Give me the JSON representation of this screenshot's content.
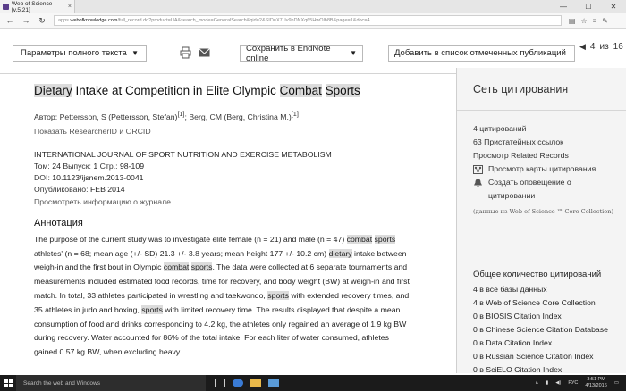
{
  "browser": {
    "tab_title": "Web of Science [v.5.21]",
    "url_prefix": "apps.",
    "url_domain": "webofknowledge.com",
    "url_rest": "/full_record.do?product=UA&search_mode=GeneralSearch&qid=2&SID=X7Uv9hDNXq65HwOlh8B&page=1&doc=4"
  },
  "toolbar": {
    "fulltext_label": "Параметры полного текста",
    "endnote_label": "Сохранить в EndNote online",
    "marked_label": "Добавить в список отмеченных публикаций",
    "page_current": "4",
    "page_of": "из",
    "page_total": "16"
  },
  "record": {
    "title_parts": [
      "Dietary",
      " Intake at Competition in Elite Olympic ",
      "Combat",
      " ",
      "Sports"
    ],
    "author_label": "Автор:",
    "author1": "Pettersson, S",
    "author1_full": "(Pettersson, Stefan)",
    "author1_ref": "[1]",
    "author_sep": "; ",
    "author2": "Berg, CM",
    "author2_full": "(Berg, Christina M.)",
    "author2_ref": "[1]",
    "orcid_link": "Показать ResearcherID и ORCID",
    "journal": "INTERNATIONAL JOURNAL OF SPORT NUTRITION AND EXERCISE METABOLISM",
    "volume_label": "Том:",
    "volume": "24",
    "issue_label": "Выпуск:",
    "issue": "1",
    "pages_label": "Стр.:",
    "pages": "98-109",
    "doi_label": "DOI:",
    "doi": "10.1123/ijsnem.2013-0041",
    "published_label": "Опубликовано:",
    "published": "FEB 2014",
    "journal_info_link": "Просмотреть информацию о журнале",
    "abstract_heading": "Аннотация",
    "abstract_parts": [
      {
        "t": "The purpose of the current study was to investigate elite female (n = 21) and male (n = 47) ",
        "h": false
      },
      {
        "t": "combat",
        "h": true
      },
      {
        "t": " ",
        "h": false
      },
      {
        "t": "sports",
        "h": true
      },
      {
        "t": " athletes' (n = 68; mean age (+/- SD) 21.3 +/- 3.8 years; mean height 177 +/- 10.2 cm) ",
        "h": false
      },
      {
        "t": "dietary",
        "h": true
      },
      {
        "t": " intake between weigh-in and the first bout in Olympic ",
        "h": false
      },
      {
        "t": "combat",
        "h": true
      },
      {
        "t": " ",
        "h": false
      },
      {
        "t": "sports",
        "h": true
      },
      {
        "t": ". The data were collected at 6 separate tournaments and measurements included estimated food records, time for recovery, and body weight (BW) at weigh-in and first match. In total, 33 athletes participated in wrestling and taekwondo, ",
        "h": false
      },
      {
        "t": "sports",
        "h": true
      },
      {
        "t": " with extended recovery times, and 35 athletes in judo and boxing, ",
        "h": false
      },
      {
        "t": "sports",
        "h": true
      },
      {
        "t": " with limited recovery time. The results displayed that despite a mean consumption of food and drinks corresponding to 4.2 kg, the athletes only regained an average of 1.9 kg BW during recovery. Water accounted for 86% of the total intake. For each liter of water consumed, athletes gained 0.57 kg BW, when excluding heavy",
        "h": false
      }
    ]
  },
  "citation_panel": {
    "heading": "Сеть цитирования",
    "citations": "4 цитирований",
    "cited_refs": "63 Пристатейных ссылок",
    "related": "Просмотр Related Records",
    "citation_map": "Просмотр карты цитирования",
    "alert": "Создать оповещение о цитировании",
    "source_note": "(данные из Web of Science ™ Core Collection)",
    "total_heading": "Общее количество цитирований",
    "totals": [
      "4 в все базы данных",
      "4 в Web of Science Core Collection",
      "0 в BIOSIS Citation Index",
      "0 в Chinese Science Citation Database",
      "0 в Data Citation Index",
      "0 в Russian Science Citation Index",
      "0 в SciELO Citation Index"
    ]
  },
  "taskbar": {
    "search_placeholder": "Search the web and Windows",
    "lang": "РУС",
    "time": "3:51 PM",
    "date": "4/13/2016"
  }
}
